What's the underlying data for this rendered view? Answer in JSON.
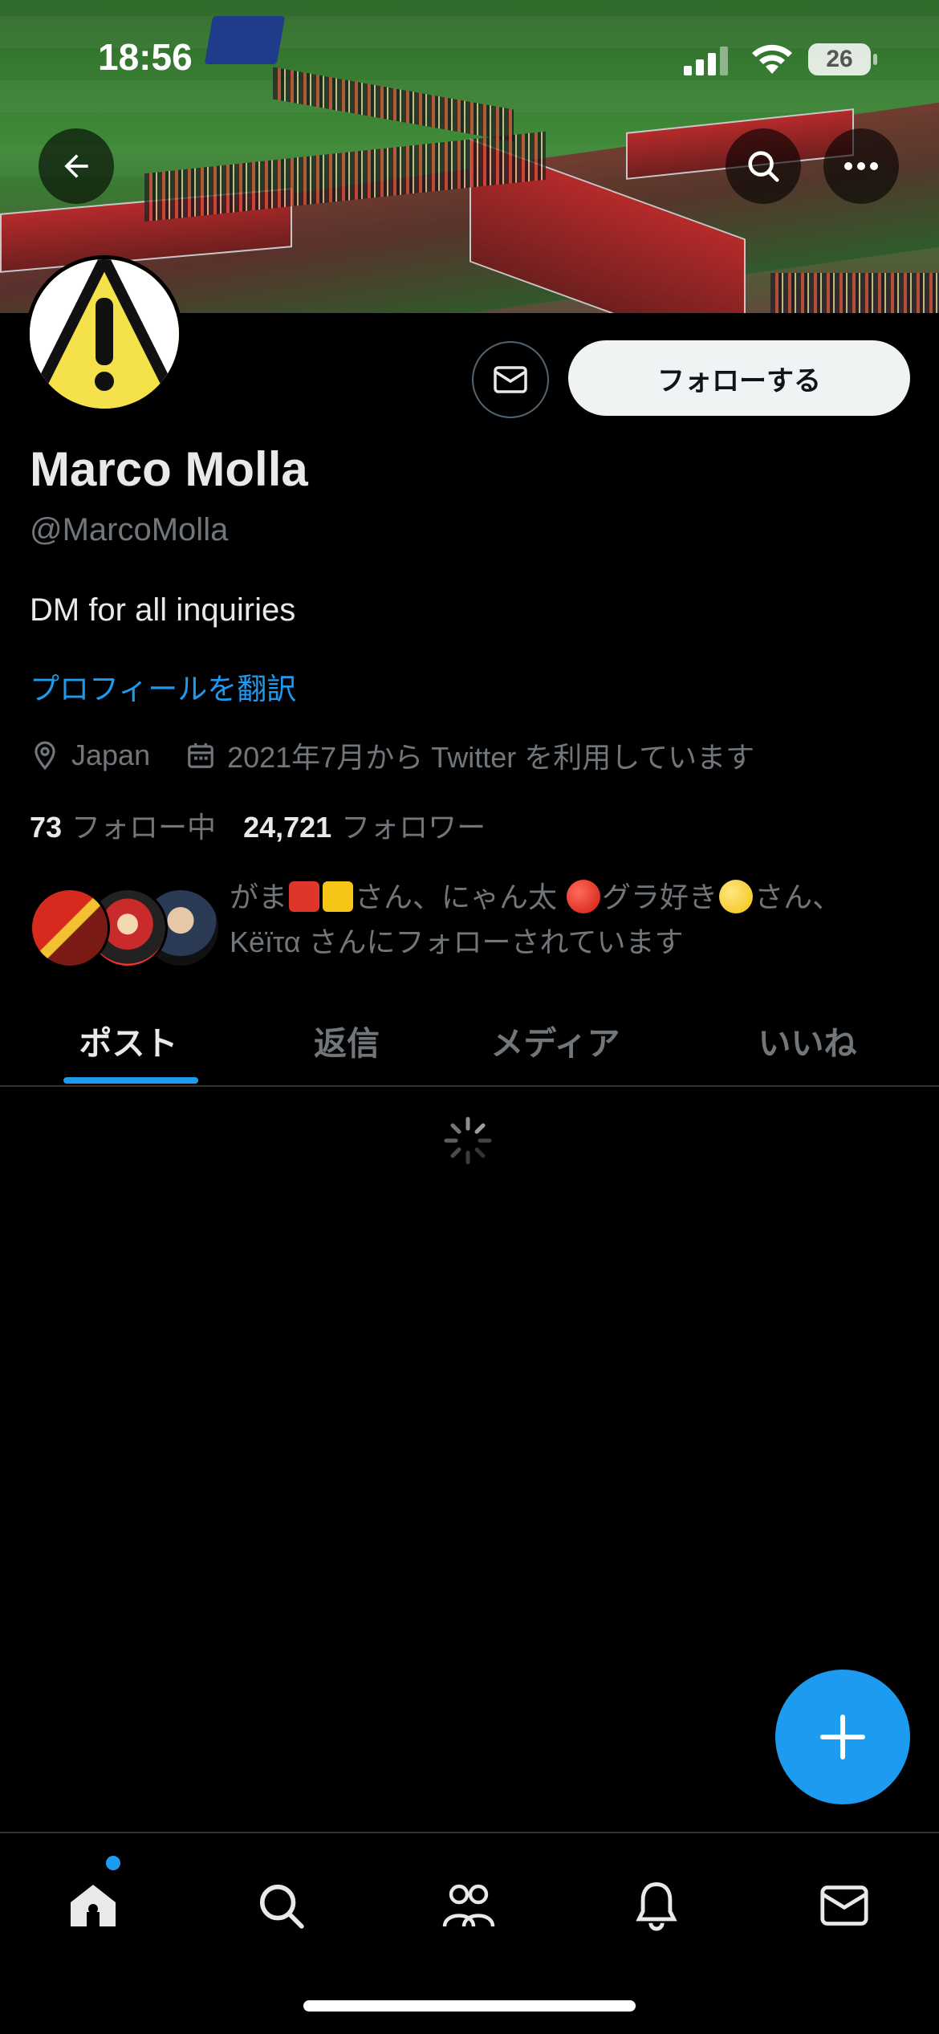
{
  "status_bar": {
    "time": "18:56",
    "battery": "26"
  },
  "profile": {
    "display_name": "Marco Molla",
    "handle": "@MarcoMolla",
    "bio": "DM for all inquiries",
    "translate_link": "プロフィールを翻訳",
    "location": "Japan",
    "joined": "2021年7月から Twitter を利用しています",
    "following_count": "73",
    "following_label": "フォロー中",
    "followers_count": "24,721",
    "followers_label": "フォロワー",
    "followed_by": {
      "line1_start": "がま",
      "line1_mid": "さん、にゃん太",
      "line1_mid2": "グラ好き",
      "line1_end": "さん、",
      "line2": "Këïτα さんにフォローされています"
    }
  },
  "buttons": {
    "follow": "フォローする"
  },
  "tabs": [
    {
      "label": "ポスト",
      "active": true
    },
    {
      "label": "返信",
      "active": false
    },
    {
      "label": "メディア",
      "active": false
    },
    {
      "label": "いいね",
      "active": false
    }
  ],
  "bottom_nav": [
    "home-icon",
    "search-icon",
    "communities-icon",
    "notifications-icon",
    "messages-icon"
  ],
  "colors": {
    "accent": "#1d9bf0",
    "background": "#000000",
    "secondary_text": "#71767b",
    "follow_button_bg": "#eff3f4"
  }
}
